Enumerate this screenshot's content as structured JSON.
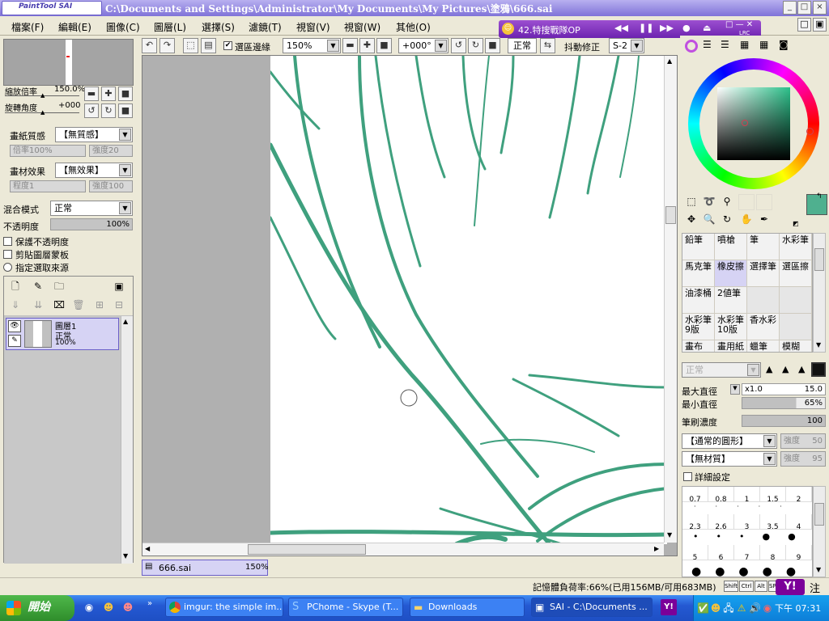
{
  "app": {
    "logo_text": "PaintTool SAI",
    "title": "C:\\Documents and Settings\\Administrator\\My Documents\\My Pictures\\塗鴉\\666.sai"
  },
  "menu": [
    "檔案(F)",
    "編輯(E)",
    "圖像(C)",
    "圖層(L)",
    "選擇(S)",
    "濾鏡(T)",
    "視窗(V)",
    "視窗(W)",
    "其他(O)"
  ],
  "player": {
    "track": "42.特搜戰隊OP",
    "lrc": "LRC"
  },
  "toolbar": {
    "selection_edge_label": "選區邊緣",
    "zoom": "150%",
    "rotation": "+000°",
    "mode": "正常",
    "stabilizer_label": "抖動修正",
    "stabilizer": "S-2"
  },
  "navigator": {
    "zoom_label": "縮放倍率",
    "zoom_value": "150.0%",
    "angle_label": "旋轉角度",
    "angle_value": "+000"
  },
  "paper": {
    "texture_label": "畫紙質感",
    "texture_value": "【無質感】",
    "scale_label": "倍率",
    "scale_value": "100%",
    "strength_label": "強度",
    "strength_value": "20",
    "effect_label": "畫材效果",
    "effect_value": "【無效果】",
    "degree_label": "程度",
    "degree_value": "1",
    "strength2_value": "100"
  },
  "layer_props": {
    "blend_label": "混合模式",
    "blend_value": "正常",
    "opacity_label": "不透明度",
    "opacity_value": "100%",
    "preserve_opacity": "保護不透明度",
    "clip_mask": "剪貼圖層蒙板",
    "selection_source": "指定選取來源"
  },
  "layer": {
    "name": "圖層1",
    "mode": "正常",
    "opacity": "100%"
  },
  "tools": [
    [
      "鉛筆",
      "噴槍",
      "筆",
      "水彩筆"
    ],
    [
      "馬克筆",
      "橡皮擦",
      "選擇筆",
      "選區擦"
    ],
    [
      "油漆桶",
      "2値筆",
      "",
      ""
    ],
    [
      "水彩筆9版",
      "水彩筆10版",
      "香水彩",
      ""
    ],
    [
      "畫布",
      "畫用紙",
      "蠟筆",
      "模糊"
    ]
  ],
  "brush": {
    "mode": "正常",
    "max_diameter_label": "最大直徑",
    "max_multiplier": "x1.0",
    "max_value": "15.0",
    "min_diameter_label": "最小直徑",
    "min_value": "65%",
    "min_fraction": 0.65,
    "density_label": "筆刷濃度",
    "density_value": "100",
    "shape_value": "【通常的圓形】",
    "shape_strength_label": "強度",
    "shape_strength": "50",
    "texture_value": "【無材質】",
    "texture_strength_label": "強度",
    "texture_strength": "95",
    "detail_label": "詳細設定"
  },
  "presets": [
    [
      "0.7",
      "0.8",
      "1",
      "1.5",
      "2"
    ],
    [
      "2.3",
      "2.6",
      "3",
      "3.5",
      "4"
    ],
    [
      "5",
      "6",
      "7",
      "8",
      "9"
    ]
  ],
  "doc_tab": {
    "name": "666.sai",
    "zoom": "150%"
  },
  "status": {
    "memory": "記憶體負荷率:66%(已用156MB/可用683MB)",
    "keys": [
      "Shift",
      "Ctrl",
      "Alt",
      "SPC"
    ],
    "ime": "注"
  },
  "colors": {
    "accent": "#7f72d8",
    "current_color": "#4fb08f",
    "stroke": "#3fa07e"
  },
  "taskbar": {
    "start": "開始",
    "tasks": [
      "imgur: the simple im...",
      "PChome - Skype (T...",
      "Downloads",
      "SAI - C:\\Documents ..."
    ],
    "clock": "下午 07:31"
  }
}
